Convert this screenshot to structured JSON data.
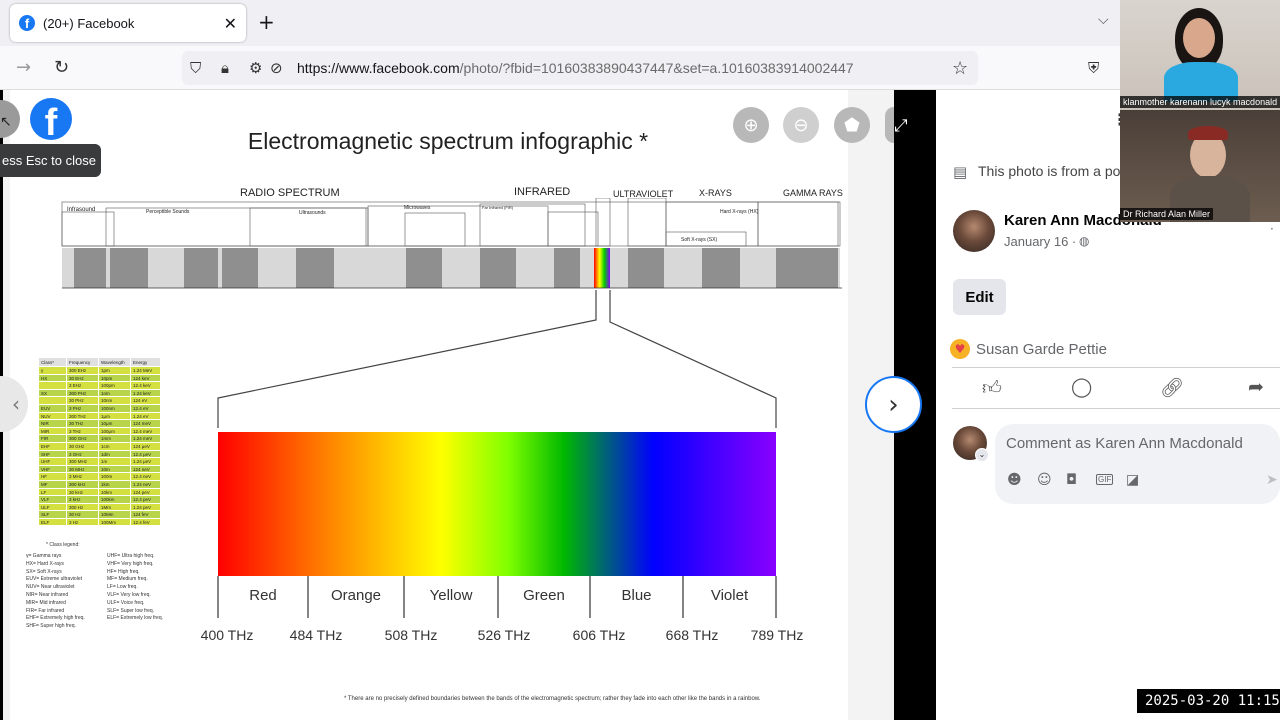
{
  "browser": {
    "tab_title": "(20+) Facebook",
    "tab_close": "✕",
    "new_tab": "+",
    "url_domain": "https://www.facebook.com",
    "url_path": "/photo/?fbid=10160383890437447&set=a.10160383914002447"
  },
  "viewer": {
    "tooltip": "ess Esc to close",
    "icons": [
      "zoom-in-icon",
      "zoom-out-icon",
      "tag-icon",
      "fullscreen-icon",
      "next-icon",
      "previous-icon"
    ]
  },
  "infographic": {
    "title": "Electromagnetic spectrum infographic *",
    "band_headers": [
      "RADIO SPECTRUM",
      "INFRARED",
      "ULTRAVIOLET",
      "X-RAYS",
      "GAMMA RAYS"
    ],
    "sub_bands": [
      "Infrasound",
      "Perceptible Sounds",
      "Ultrasounds",
      "Microwaves",
      "Far Infrared (FIR)",
      "Hard X-rays (HX)",
      "Soft X-rays (SX)"
    ],
    "colors": [
      "Red",
      "Orange",
      "Yellow",
      "Green",
      "Blue",
      "Violet"
    ],
    "frequencies": [
      "400 THz",
      "484 THz",
      "508 THz",
      "526 THz",
      "606 THz",
      "668 THz",
      "789 THz"
    ],
    "table_header": [
      "Class*",
      "Frequency",
      "Wavelength",
      "Energy"
    ],
    "table_rows": [
      [
        "γ",
        "300 EHz",
        "1pm",
        "1.24 MeV"
      ],
      [
        "HX",
        "30 EHz",
        "10pm",
        "124 keV"
      ],
      [
        "",
        "3 EHz",
        "100pm",
        "12.4 keV"
      ],
      [
        "SX",
        "300 PHz",
        "1nm",
        "1.24 keV"
      ],
      [
        "",
        "30 PHz",
        "10nm",
        "124 eV"
      ],
      [
        "EUV",
        "3 PHz",
        "100nm",
        "12.4 eV"
      ],
      [
        "NUV",
        "300 THz",
        "1μm",
        "1.24 eV"
      ],
      [
        "NIR",
        "30 THz",
        "10μm",
        "124 meV"
      ],
      [
        "MIR",
        "3 THz",
        "100μm",
        "12.4 meV"
      ],
      [
        "FIR",
        "300 GHz",
        "1mm",
        "1.24 meV"
      ],
      [
        "EHF",
        "30 GHz",
        "1cm",
        "124 μeV"
      ],
      [
        "SHF",
        "3 GHz",
        "1dm",
        "12.4 μeV"
      ],
      [
        "UHF",
        "300 MHz",
        "1m",
        "1.24 μeV"
      ],
      [
        "VHF",
        "30 MHz",
        "10m",
        "124 neV"
      ],
      [
        "HF",
        "3 MHz",
        "100m",
        "12.4 neV"
      ],
      [
        "MF",
        "300 kHz",
        "1km",
        "1.24 neV"
      ],
      [
        "LF",
        "30 kHz",
        "10km",
        "124 peV"
      ],
      [
        "VLF",
        "3 kHz",
        "100km",
        "12.4 peV"
      ],
      [
        "ULF",
        "300 Hz",
        "1Mm",
        "1.24 peV"
      ],
      [
        "SLF",
        "30 Hz",
        "10Mm",
        "124 feV"
      ],
      [
        "ELF",
        "3 Hz",
        "100Mm",
        "12.4 feV"
      ]
    ],
    "legend_title": "* Class legend:",
    "legend_left": [
      "γ= Gamma rays",
      "HX= Hard X-rays",
      "SX= Soft X-rays",
      "EUV= Extreme ultraviolet",
      "NUV= Near ultraviolet",
      "NIR= Near infrared",
      "MIR= Mid infrared",
      "FIR= Far infrared",
      "EHF= Extremely high freq.",
      "SHF= Super high freq."
    ],
    "legend_right": [
      "UHF= Ultra high freq.",
      "VHF= Very high freq.",
      "HF= High freq.",
      "MF= Medium freq.",
      "LF= Low freq.",
      "VLF= Very low freq.",
      "ULF= Voice freq.",
      "SLF= Super low freq.",
      "ELF= Extremely low freq."
    ],
    "footnote": "* There are no precisely defined boundaries between the bands of the electromagnetic spectrum; rather they fade into each other like the bands in a rainbow."
  },
  "panel": {
    "source_text": "This photo is from a po",
    "author": "Karen Ann Macdonald",
    "date": "January 16 ·",
    "edit_label": "Edit",
    "reaction_name": "Susan Garde Pettie",
    "comment_placeholder": "Comment as Karen Ann Macdonald"
  },
  "video": {
    "participant1": "klanmother karenann lucyk macdonald",
    "participant2": "Dr Richard Alan Miller",
    "timestamp": "2025-03-20 11:15:"
  }
}
